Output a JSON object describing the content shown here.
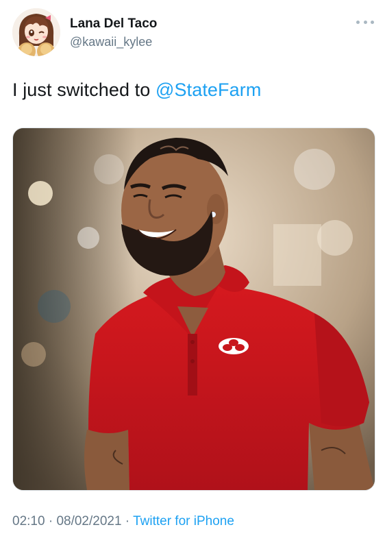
{
  "tweet": {
    "author": {
      "display_name": "Lana Del Taco",
      "handle": "@kawaii_kylee"
    },
    "text_before": "I just switched to ",
    "mention": "@StateFarm",
    "time": "02:10",
    "separator": " · ",
    "date": "08/02/2021",
    "source": "Twitter for iPhone"
  },
  "colors": {
    "link": "#1da1f2",
    "secondary_text": "#657786",
    "shirt_red": "#c8171c"
  },
  "icons": [
    "more-options-icon",
    "statefarm-logo"
  ]
}
